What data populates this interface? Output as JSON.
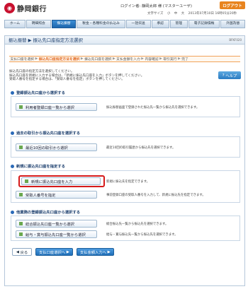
{
  "header": {
    "bank_name": "静岡銀行",
    "login_info": "ログイン者: 静岡太郎 様 (マスターユーザ)",
    "sub_links": [
      "文字サイズ",
      "小",
      "中",
      "大",
      "2013年07月10日 16時05分20秒"
    ],
    "logout_label": "ログアウト"
  },
  "nav": {
    "tabs": [
      "ホーム",
      "明細照会",
      "振込振替",
      "税金・各種料金の払込み",
      "一括伝送",
      "承認",
      "管理",
      "電子記録債権",
      "外国為替"
    ],
    "active": "振込振替"
  },
  "page": {
    "title": "振込振替 ▶ 振込先口座指定方法選択",
    "code": "BFKF020",
    "steps": [
      "支払口座を選択",
      "振込先口座指定方法を選択",
      "振込先口座を選択",
      "支払金額を入力",
      "内容確認",
      "取引実行",
      "完了"
    ],
    "active_step": "振込先口座指定方法を選択",
    "intro_lines": [
      "振込先口座の指定方法を選択してください。",
      "振込先口座を新規に入力する場合は、「新規に振込先口座を入力」ボタンを押してください。",
      "受取人番号を指定する場合は、「受取人番号を指定」ボタンを押してください。"
    ],
    "help_label": "ヘルプ"
  },
  "sections": [
    {
      "title": "登録振込先口座から選択する",
      "rows": [
        {
          "button": "利用者登録口座一覧から選択",
          "desc": "振込振替画面で登録された振込先一覧から振込先を選択できます。"
        }
      ]
    },
    {
      "title": "過去の取引から振込先口座を選択する",
      "rows": [
        {
          "button": "最近10回の取引から選択",
          "desc": "最近10回の取引履歴から振込先を選択できます。"
        }
      ]
    },
    {
      "title": "新規に振込先口座を指定する",
      "rows": [
        {
          "button": "新規に振込先口座を入力",
          "desc": "新規に振込先を指定できます。"
        },
        {
          "button": "受取人番号を指定",
          "desc": "事前登録口座の受取人番号を入力して、新規に振込先を指定できます。"
        }
      ]
    },
    {
      "title": "他業務の登録振込先口座から選択する",
      "rows": [
        {
          "button": "総合振込先口座一覧から選択",
          "desc": "総合振込先一覧から振込先を選択できます。"
        },
        {
          "button": "給与・賞与振込先口座一覧から選択",
          "desc": "給与・賞与振込先一覧から振込先を選択できます。"
        }
      ]
    }
  ],
  "footer": {
    "back_label": "戻る",
    "source_account_label": "支払口座選択へ",
    "amount_label": "支払金額入力へ"
  },
  "colors": {
    "accent_blue": "#1c66ad",
    "step_orange": "#e0641a",
    "highlight_red": "#d51a1a",
    "logout_orange": "#e8841f"
  }
}
